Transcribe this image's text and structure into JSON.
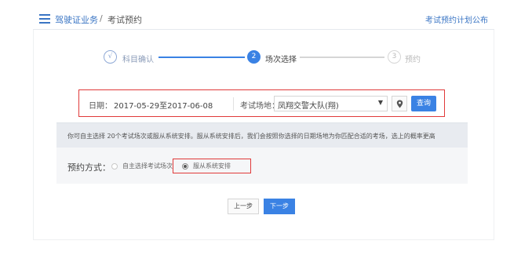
{
  "header": {
    "crumb_main": "驾驶证业务",
    "crumb_separator": "/",
    "crumb_current": "考试预约",
    "right_link": "考试预约计划公布"
  },
  "steps": [
    {
      "marker": "√",
      "label": "科目确认",
      "state": "done"
    },
    {
      "marker": "2",
      "label": "场次选择",
      "state": "active"
    },
    {
      "marker": "3",
      "label": "预约",
      "state": "todo"
    }
  ],
  "search": {
    "date_label": "日期：",
    "date_value": "2017-05-29至2017-06-08",
    "venue_label": "考试场地：",
    "venue_value": "凤翔交警大队(翔)",
    "venue_caret": "▼",
    "query_label": "查询"
  },
  "notice": {
    "text": "你可自主选择 20个考试场次或服从系统安排。服从系统安排后，我们会按照你选择的日期场地为你匹配合适的考场，选上的概率更高"
  },
  "method": {
    "label": "预约方式：",
    "options": [
      {
        "label": "自主选择考试场次",
        "checked": false
      },
      {
        "label": "服从系统安排",
        "checked": true
      }
    ]
  },
  "actions": {
    "prev_label": "上一步",
    "next_label": "下一步"
  },
  "colors": {
    "accent": "#3a82e4",
    "highlight_border": "#e03a3a",
    "notice_bg": "#e8ebf0"
  },
  "icons": [
    "menu-icon",
    "location-pin-icon",
    "check-icon"
  ]
}
